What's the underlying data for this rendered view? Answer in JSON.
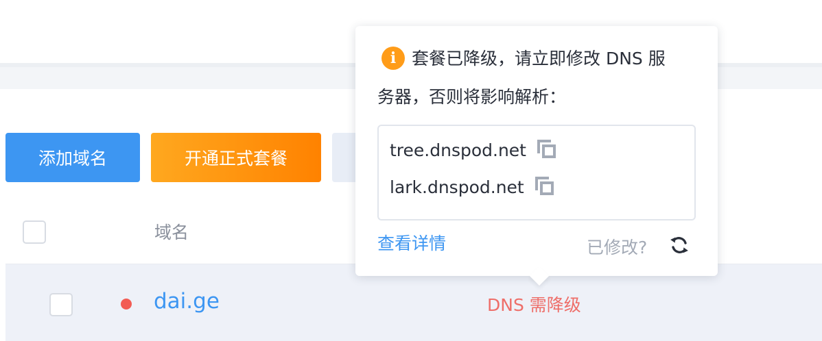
{
  "toolbar": {
    "add_domain_label": "添加域名",
    "open_plan_label": "开通正式套餐"
  },
  "table": {
    "header_domain": "域名",
    "rows": [
      {
        "domain": "dai.ge",
        "dns_status": "DNS 需降级"
      }
    ]
  },
  "popover": {
    "info_icon": "i",
    "warning_line1": "套餐已降级，请立即修改 DNS 服",
    "warning_line2": "务器，否则将影响解析：",
    "nameservers": [
      "tree.dnspod.net",
      "lark.dnspod.net"
    ],
    "detail_link": "查看详情",
    "modified_question": "已修改?"
  },
  "colors": {
    "primary": "#3d96f2",
    "orange": "#ff9c19",
    "danger": "#ee6e69",
    "row_highlight": "#eef1f8"
  }
}
